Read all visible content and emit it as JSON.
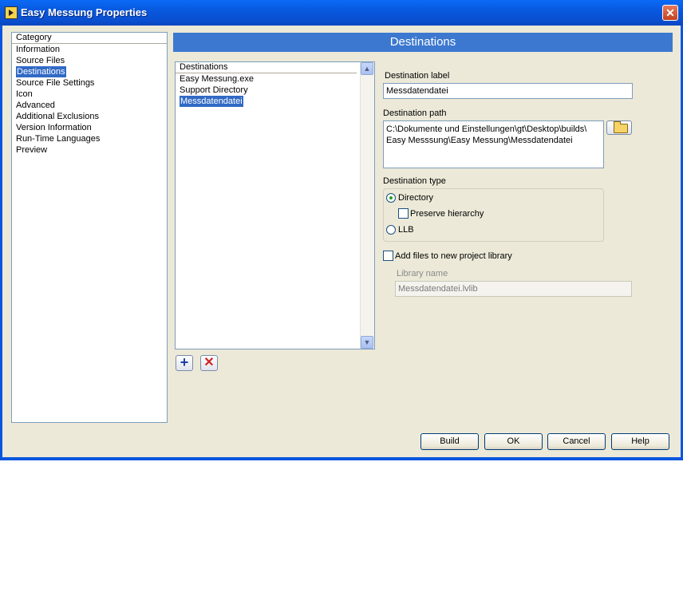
{
  "window": {
    "title": "Easy Messung Properties"
  },
  "category": {
    "header": "Category",
    "items": [
      {
        "label": "Information"
      },
      {
        "label": "Source Files"
      },
      {
        "label": "Destinations",
        "selected": true
      },
      {
        "label": "Source File Settings"
      },
      {
        "label": "Icon"
      },
      {
        "label": "Advanced"
      },
      {
        "label": "Additional Exclusions"
      },
      {
        "label": "Version Information"
      },
      {
        "label": "Run-Time Languages"
      },
      {
        "label": "Preview"
      }
    ]
  },
  "panel": {
    "title": "Destinations"
  },
  "destinations": {
    "header": "Destinations",
    "items": [
      {
        "label": "Easy Messung.exe"
      },
      {
        "label": "Support Directory"
      },
      {
        "label": "Messdatendatei",
        "selected": true
      }
    ]
  },
  "form": {
    "dest_label_caption": "Destination label",
    "dest_label_value": "Messdatendatei",
    "dest_path_caption": "Destination path",
    "dest_path_line1": "C:\\Dokumente und Einstellungen\\gt\\Desktop\\builds\\",
    "dest_path_line2": "Easy Messsung\\Easy Messung\\Messdatendatei",
    "dest_type_caption": "Destination type",
    "radio_directory": "Directory",
    "radio_directory_selected": true,
    "preserve_hierarchy": "Preserve hierarchy",
    "preserve_hierarchy_checked": false,
    "radio_llb": "LLB",
    "radio_llb_selected": false,
    "add_files_label": "Add files to new project library",
    "add_files_checked": false,
    "library_name_caption": "Library name",
    "library_name_value": "Messdatendatei.lvlib"
  },
  "buttons": {
    "build": "Build",
    "ok": "OK",
    "cancel": "Cancel",
    "help": "Help"
  },
  "icons": {
    "add": "plus-icon",
    "delete": "x-icon",
    "browse": "folder-open-icon",
    "accent": "#316ac5",
    "add_color": "#1a3fa8",
    "delete_color": "#d02424"
  }
}
